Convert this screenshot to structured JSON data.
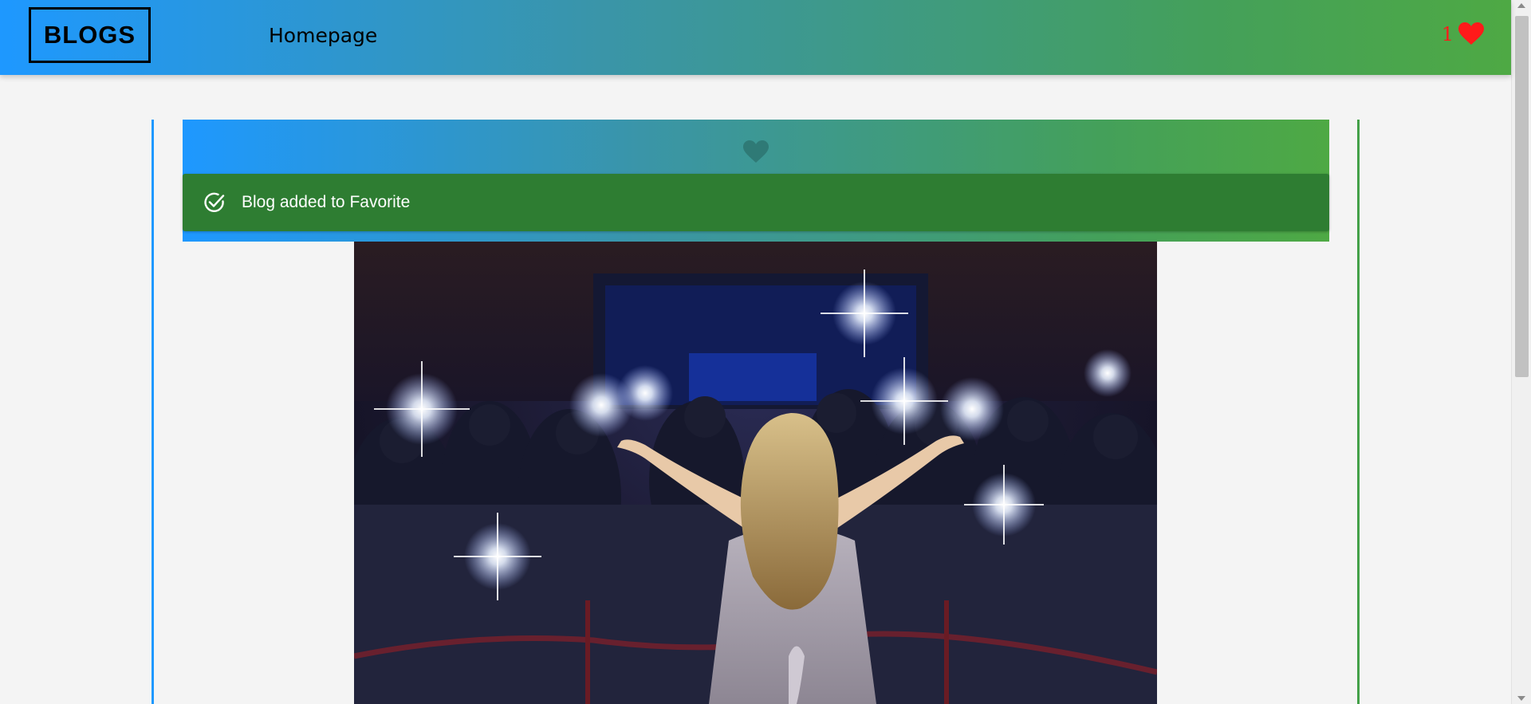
{
  "header": {
    "logo": "BLOGS",
    "nav_home": "Homepage",
    "favorites_count": "1"
  },
  "banner": {
    "toast_message": "Blog added to Favorite"
  },
  "colors": {
    "gradient_start": "#1e98ff",
    "gradient_end": "#4ea944",
    "toast_bg": "#2e7d32",
    "favorite_red": "#ff1a1a"
  },
  "icons": {
    "favorites": "heart-icon",
    "banner_favorite": "heart-icon",
    "toast": "check-circle-icon"
  },
  "image": {
    "alt": "Performer on red carpet facing photographers with camera flashes"
  }
}
